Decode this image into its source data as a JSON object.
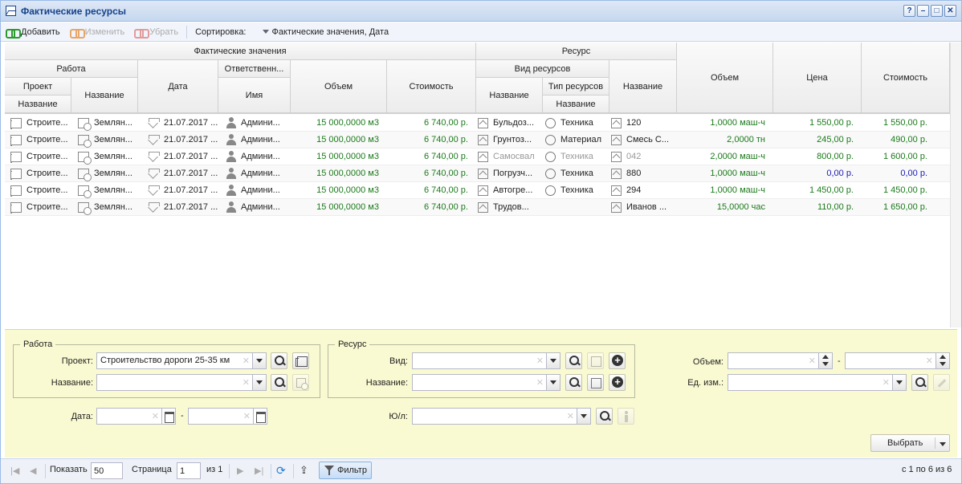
{
  "window": {
    "title": "Фактические ресурсы",
    "buttons": [
      "?",
      "–",
      "□",
      "✕"
    ]
  },
  "toolbar": {
    "add": "Добавить",
    "edit": "Изменить",
    "remove": "Убрать",
    "sort_label": "Сортировка:",
    "sort_value": "Фактические значения, Дата"
  },
  "headers": {
    "actual": "Фактические значения",
    "work": "Работа",
    "project": "Проект",
    "project_name": "Название",
    "work_name": "Название",
    "date": "Дата",
    "responsible": "Ответственн...",
    "resp_name": "Имя",
    "volume": "Объем",
    "cost": "Стоимость",
    "resource": "Ресурс",
    "res_kind": "Вид ресурсов",
    "kind_name": "Название",
    "res_type": "Тип ресурсов",
    "type_name": "Название",
    "res_name": "Название",
    "r_volume": "Объем",
    "price": "Цена",
    "r_cost": "Стоимость"
  },
  "rows": [
    {
      "project": "Строите...",
      "work": "Землян...",
      "date": "21.07.2017 ...",
      "resp": "Админи...",
      "volume": "15 000,0000 м3",
      "cost": "6 740,00 р.",
      "kind": "Бульдоз...",
      "type": "Техника",
      "name": "120",
      "r_volume": "1,0000 маш-ч",
      "price": "1 550,00 р.",
      "r_cost": "1 550,00 р.",
      "state": "normal",
      "has_type": true
    },
    {
      "project": "Строите...",
      "work": "Землян...",
      "date": "21.07.2017 ...",
      "resp": "Админи...",
      "volume": "15 000,0000 м3",
      "cost": "6 740,00 р.",
      "kind": "Грунтоз...",
      "type": "Материал",
      "name": "Смесь С...",
      "r_volume": "2,0000 тн",
      "price": "245,00 р.",
      "r_cost": "490,00 р.",
      "state": "normal",
      "has_type": true
    },
    {
      "project": "Строите...",
      "work": "Землян...",
      "date": "21.07.2017 ...",
      "resp": "Админи...",
      "volume": "15 000,0000 м3",
      "cost": "6 740,00 р.",
      "kind": "Самосвал",
      "type": "Техника",
      "name": "042",
      "r_volume": "2,0000 маш-ч",
      "price": "800,00 р.",
      "r_cost": "1 600,00 р.",
      "state": "gray",
      "has_type": true
    },
    {
      "project": "Строите...",
      "work": "Землян...",
      "date": "21.07.2017 ...",
      "resp": "Админи...",
      "volume": "15 000,0000 м3",
      "cost": "6 740,00 р.",
      "kind": "Погрузч...",
      "type": "Техника",
      "name": "880",
      "r_volume": "1,0000 маш-ч",
      "price": "0,00 р.",
      "r_cost": "0,00 р.",
      "state": "blue",
      "has_type": true
    },
    {
      "project": "Строите...",
      "work": "Землян...",
      "date": "21.07.2017 ...",
      "resp": "Админи...",
      "volume": "15 000,0000 м3",
      "cost": "6 740,00 р.",
      "kind": "Автогре...",
      "type": "Техника",
      "name": "294",
      "r_volume": "1,0000 маш-ч",
      "price": "1 450,00 р.",
      "r_cost": "1 450,00 р.",
      "state": "normal",
      "has_type": true
    },
    {
      "project": "Строите...",
      "work": "Землян...",
      "date": "21.07.2017 ...",
      "resp": "Админи...",
      "volume": "15 000,0000 м3",
      "cost": "6 740,00 р.",
      "kind": "Трудов...",
      "type": "",
      "name": "Иванов ...",
      "r_volume": "15,0000 час",
      "price": "110,00 р.",
      "r_cost": "1 650,00 р.",
      "state": "normal",
      "has_type": false
    }
  ],
  "filter": {
    "work_legend": "Работа",
    "project_label": "Проект:",
    "project_value": "Строительство дороги 25-35 км",
    "name_label": "Название:",
    "date_label": "Дата:",
    "dash": "-",
    "resource_legend": "Ресурс",
    "kind_label": "Вид:",
    "rname_label": "Название:",
    "legal_label": "Ю/л:",
    "volume_label": "Объем:",
    "unit_label": "Ед. изм.:",
    "select_button": "Выбрать"
  },
  "pager": {
    "show_label": "Показать",
    "page_size": "50",
    "page_label": "Страница",
    "page": "1",
    "of": "из 1",
    "filter_button": "Фильтр",
    "summary": "с 1 по 6 из 6"
  },
  "colors": {
    "number_green": "#1a7a1a",
    "blue_value": "#1a1ab8",
    "filter_bg": "#fafad2",
    "title_text": "#15428b"
  }
}
